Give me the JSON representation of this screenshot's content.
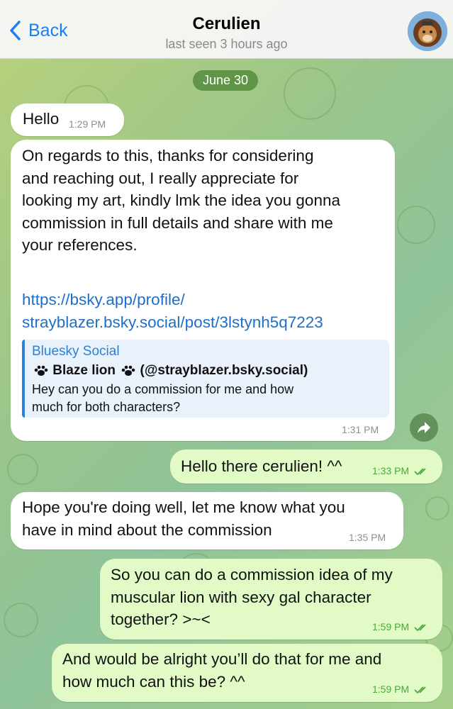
{
  "header": {
    "back_label": "Back",
    "title": "Cerulien",
    "status": "last seen 3 hours ago"
  },
  "date_separator": "June 30",
  "messages": [
    {
      "direction": "incoming",
      "text": "Hello",
      "time": "1:29 PM"
    },
    {
      "direction": "incoming",
      "lines": [
        "On regards to this, thanks for considering",
        "and reaching out, I really appreciate for",
        "looking my art, kindly lmk the idea you gonna",
        "commission in full details and share with me",
        "your references."
      ],
      "link_lines": [
        "https://bsky.app/profile/",
        "strayblazer.bsky.social/post/3lstynh5q7223"
      ],
      "preview": {
        "site": "Bluesky Social",
        "title_name": "Blaze lion",
        "title_handle": "(@strayblazer.bsky.social)",
        "description_lines": [
          "Hey can you do a commission for me and how",
          "much for both characters?"
        ]
      },
      "time": "1:31 PM"
    },
    {
      "direction": "outgoing",
      "text": "Hello there cerulien! ^^",
      "time": "1:33 PM"
    },
    {
      "direction": "incoming",
      "lines": [
        "Hope you're doing well, let me know what you",
        "have in mind about the commission"
      ],
      "time": "1:35 PM"
    },
    {
      "direction": "outgoing",
      "lines": [
        "So you can do a commission idea of my",
        "muscular lion with sexy gal character",
        "together? >~<"
      ],
      "time": "1:59 PM"
    },
    {
      "direction": "outgoing",
      "lines": [
        "And would be alright you’ll do that for me and",
        "how much can this be? ^^"
      ],
      "time": "1:59 PM"
    }
  ],
  "colors": {
    "accent": "#1a7ff2",
    "incoming_bubble": "#ffffff",
    "outgoing_bubble": "#e2fbc6",
    "link": "#1e6fc7",
    "read_check": "#4aa83d"
  },
  "icons": {
    "back": "chevron-left-icon",
    "share": "share-arrow-icon",
    "read": "double-check-icon",
    "paw": "paw-print-icon"
  }
}
